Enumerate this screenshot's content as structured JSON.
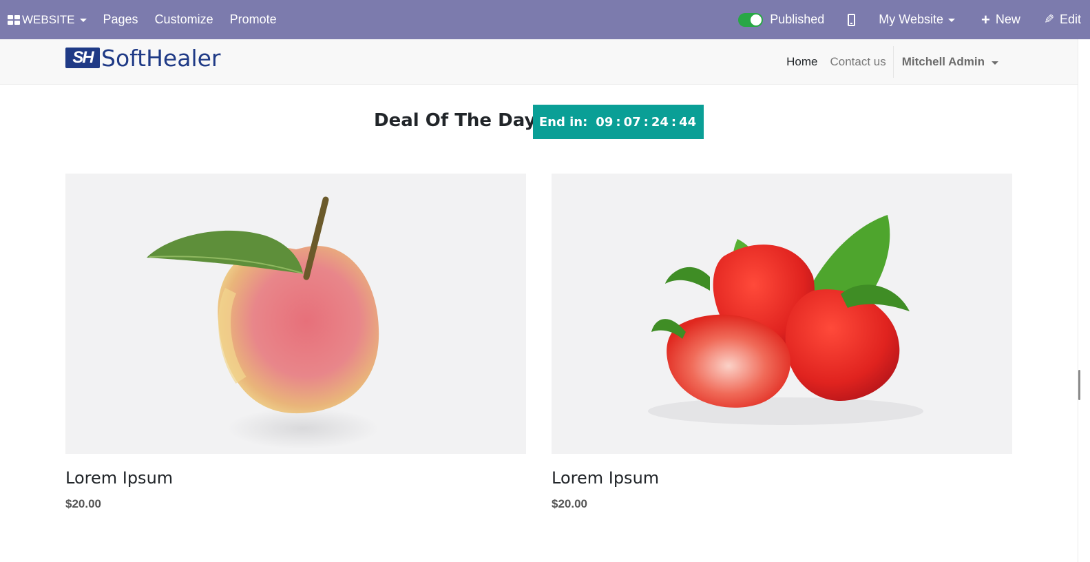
{
  "admin_bar": {
    "app_menu_label": "WEBSITE",
    "pages_label": "Pages",
    "customize_label": "Customize",
    "promote_label": "Promote",
    "published_label": "Published",
    "published": true,
    "website_selector_label": "My Website",
    "new_label": "New",
    "edit_label": "Edit",
    "background_color": "#7c7bad"
  },
  "site_header": {
    "logo_text": "SoftHealer",
    "logo_mark": "SH",
    "nav": [
      {
        "label": "Home"
      },
      {
        "label": "Contact us"
      }
    ],
    "user_name": "Mitchell Admin"
  },
  "deal": {
    "title": "Deal Of The Day",
    "countdown_prefix": "End in:",
    "days": "09",
    "hours": "07",
    "minutes": "24",
    "seconds": "44",
    "separator": ":",
    "accent_color": "#0a9f96"
  },
  "products": [
    {
      "name": "Lorem Ipsum",
      "price": "$20.00",
      "image": "peach-image"
    },
    {
      "name": "Lorem Ipsum",
      "price": "$20.00",
      "image": "strawberries-image"
    }
  ]
}
